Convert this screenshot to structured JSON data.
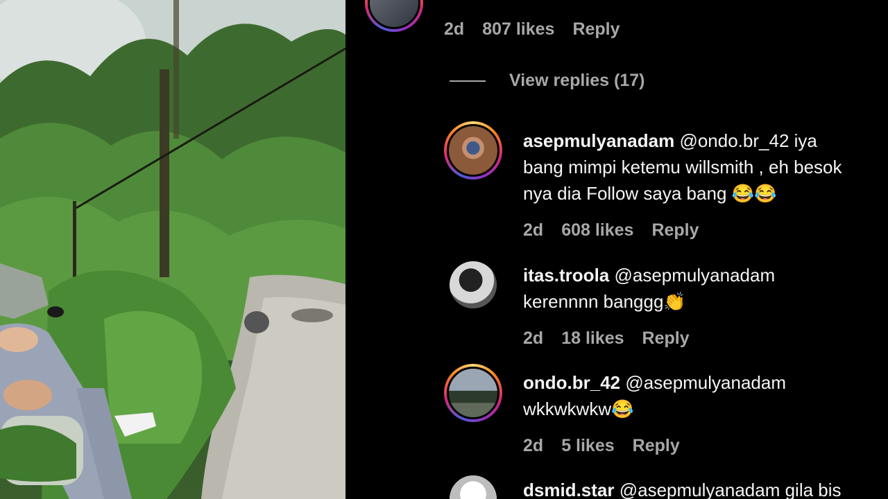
{
  "top_comment": {
    "time": "2d",
    "likes": "807 likes",
    "reply": "Reply"
  },
  "view_replies": "View replies (17)",
  "replies": [
    {
      "username": "asepmulyanadam",
      "lines": [
        "@ondo.br_42 iya",
        "bang mimpi ketemu willsmith , eh besok",
        "nya dia Follow saya bang 😂😂"
      ],
      "time": "2d",
      "likes": "608 likes",
      "reply": "Reply"
    },
    {
      "username": "itas.troola",
      "lines": [
        "@asepmulyanadam",
        "kerennnn banggg👏"
      ],
      "time": "2d",
      "likes": "18 likes",
      "reply": "Reply"
    },
    {
      "username": "ondo.br_42",
      "lines": [
        "@asepmulyanadam",
        "wkkwkwkw😂"
      ],
      "time": "2d",
      "likes": "5 likes",
      "reply": "Reply"
    },
    {
      "username": "dsmid.star",
      "lines": [
        "@asepmulyanadam gila bis"
      ]
    }
  ]
}
